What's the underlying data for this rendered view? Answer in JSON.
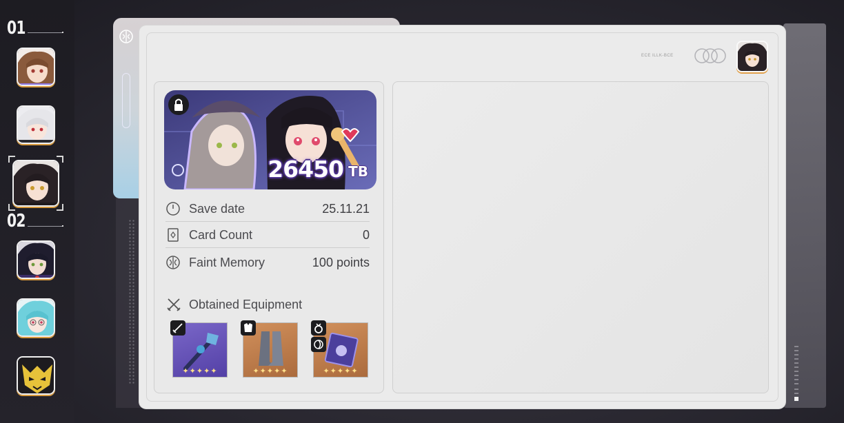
{
  "rail": {
    "groups": [
      {
        "number": "01",
        "members": [
          "character-1",
          "character-2",
          "character-3"
        ]
      },
      {
        "number": "02",
        "members": [
          "character-4",
          "character-5",
          "character-6"
        ]
      }
    ],
    "selected_index": 2
  },
  "card": {
    "header_small_text": "ECE ILLK-BCE",
    "banner": {
      "value": "26450",
      "unit": "TB",
      "locked": true
    },
    "info_rows": [
      {
        "icon": "clock-icon",
        "label": "Save date",
        "value": "25.11.21"
      },
      {
        "icon": "card-icon",
        "label": "Card Count",
        "value": "0"
      },
      {
        "icon": "brain-icon",
        "label": "Faint Memory",
        "value": "100 points"
      }
    ],
    "equipment_title": "Obtained Equipment",
    "equipment": [
      {
        "type": "weapon",
        "type_icon": "sword-icon",
        "rarity": 5,
        "stars": "✦✦✦✦✦",
        "color": "#5f4bb5"
      },
      {
        "type": "armor",
        "type_icon": "armor-icon",
        "rarity": 5,
        "stars": "✦✦✦✦✦",
        "color": "#c07f4d"
      },
      {
        "type": "accessory",
        "type_icon": "ring-icon",
        "rarity": 5,
        "stars": "✦✦✦✦✦",
        "color": "#c07f4d"
      }
    ]
  },
  "colors": {
    "panel": "#ebebeb",
    "accent_orange": "#d99a3c",
    "banner_purple": "#4a2f8c"
  }
}
